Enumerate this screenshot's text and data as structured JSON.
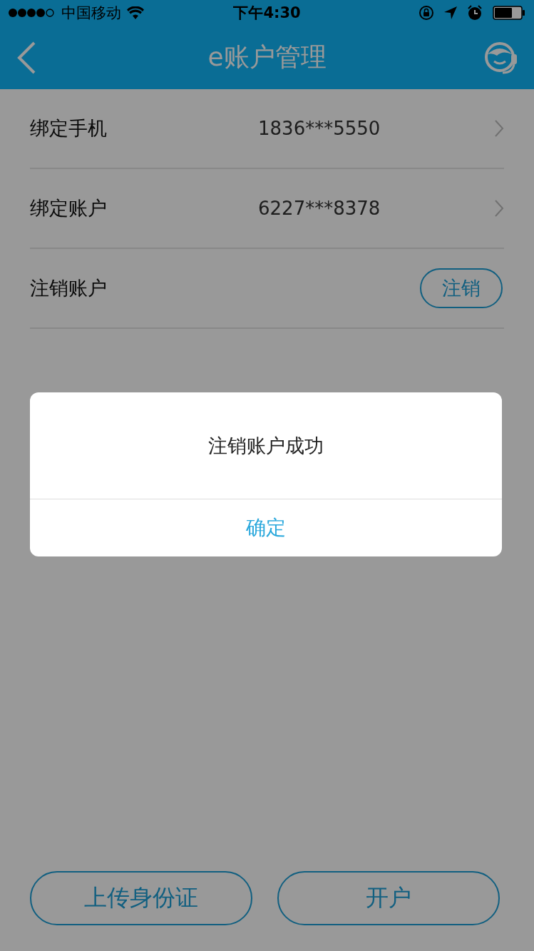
{
  "status_bar": {
    "carrier": "中国移动",
    "time": "下午4:30"
  },
  "nav": {
    "title": "e账户管理"
  },
  "rows": [
    {
      "kind": "link",
      "label": "绑定手机",
      "value": "1836***5550"
    },
    {
      "kind": "link",
      "label": "绑定账户",
      "value": "6227***8378"
    },
    {
      "kind": "action",
      "label": "注销账户",
      "button": "注销"
    }
  ],
  "bottom_buttons": [
    "上传身份证",
    "开户"
  ],
  "dialog": {
    "message": "注销账户成功",
    "confirm": "确定"
  }
}
